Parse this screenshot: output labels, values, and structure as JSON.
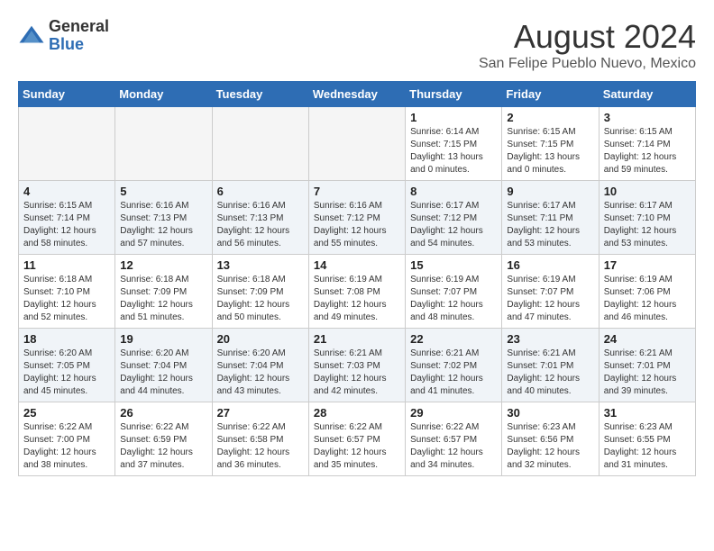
{
  "header": {
    "logo_general": "General",
    "logo_blue": "Blue",
    "month_year": "August 2024",
    "location": "San Felipe Pueblo Nuevo, Mexico"
  },
  "days_of_week": [
    "Sunday",
    "Monday",
    "Tuesday",
    "Wednesday",
    "Thursday",
    "Friday",
    "Saturday"
  ],
  "weeks": [
    [
      {
        "day": "",
        "info": "",
        "empty": true
      },
      {
        "day": "",
        "info": "",
        "empty": true
      },
      {
        "day": "",
        "info": "",
        "empty": true
      },
      {
        "day": "",
        "info": "",
        "empty": true
      },
      {
        "day": "1",
        "info": "Sunrise: 6:14 AM\nSunset: 7:15 PM\nDaylight: 13 hours\nand 0 minutes.",
        "empty": false
      },
      {
        "day": "2",
        "info": "Sunrise: 6:15 AM\nSunset: 7:15 PM\nDaylight: 13 hours\nand 0 minutes.",
        "empty": false
      },
      {
        "day": "3",
        "info": "Sunrise: 6:15 AM\nSunset: 7:14 PM\nDaylight: 12 hours\nand 59 minutes.",
        "empty": false
      }
    ],
    [
      {
        "day": "4",
        "info": "Sunrise: 6:15 AM\nSunset: 7:14 PM\nDaylight: 12 hours\nand 58 minutes.",
        "empty": false
      },
      {
        "day": "5",
        "info": "Sunrise: 6:16 AM\nSunset: 7:13 PM\nDaylight: 12 hours\nand 57 minutes.",
        "empty": false
      },
      {
        "day": "6",
        "info": "Sunrise: 6:16 AM\nSunset: 7:13 PM\nDaylight: 12 hours\nand 56 minutes.",
        "empty": false
      },
      {
        "day": "7",
        "info": "Sunrise: 6:16 AM\nSunset: 7:12 PM\nDaylight: 12 hours\nand 55 minutes.",
        "empty": false
      },
      {
        "day": "8",
        "info": "Sunrise: 6:17 AM\nSunset: 7:12 PM\nDaylight: 12 hours\nand 54 minutes.",
        "empty": false
      },
      {
        "day": "9",
        "info": "Sunrise: 6:17 AM\nSunset: 7:11 PM\nDaylight: 12 hours\nand 53 minutes.",
        "empty": false
      },
      {
        "day": "10",
        "info": "Sunrise: 6:17 AM\nSunset: 7:10 PM\nDaylight: 12 hours\nand 53 minutes.",
        "empty": false
      }
    ],
    [
      {
        "day": "11",
        "info": "Sunrise: 6:18 AM\nSunset: 7:10 PM\nDaylight: 12 hours\nand 52 minutes.",
        "empty": false
      },
      {
        "day": "12",
        "info": "Sunrise: 6:18 AM\nSunset: 7:09 PM\nDaylight: 12 hours\nand 51 minutes.",
        "empty": false
      },
      {
        "day": "13",
        "info": "Sunrise: 6:18 AM\nSunset: 7:09 PM\nDaylight: 12 hours\nand 50 minutes.",
        "empty": false
      },
      {
        "day": "14",
        "info": "Sunrise: 6:19 AM\nSunset: 7:08 PM\nDaylight: 12 hours\nand 49 minutes.",
        "empty": false
      },
      {
        "day": "15",
        "info": "Sunrise: 6:19 AM\nSunset: 7:07 PM\nDaylight: 12 hours\nand 48 minutes.",
        "empty": false
      },
      {
        "day": "16",
        "info": "Sunrise: 6:19 AM\nSunset: 7:07 PM\nDaylight: 12 hours\nand 47 minutes.",
        "empty": false
      },
      {
        "day": "17",
        "info": "Sunrise: 6:19 AM\nSunset: 7:06 PM\nDaylight: 12 hours\nand 46 minutes.",
        "empty": false
      }
    ],
    [
      {
        "day": "18",
        "info": "Sunrise: 6:20 AM\nSunset: 7:05 PM\nDaylight: 12 hours\nand 45 minutes.",
        "empty": false
      },
      {
        "day": "19",
        "info": "Sunrise: 6:20 AM\nSunset: 7:04 PM\nDaylight: 12 hours\nand 44 minutes.",
        "empty": false
      },
      {
        "day": "20",
        "info": "Sunrise: 6:20 AM\nSunset: 7:04 PM\nDaylight: 12 hours\nand 43 minutes.",
        "empty": false
      },
      {
        "day": "21",
        "info": "Sunrise: 6:21 AM\nSunset: 7:03 PM\nDaylight: 12 hours\nand 42 minutes.",
        "empty": false
      },
      {
        "day": "22",
        "info": "Sunrise: 6:21 AM\nSunset: 7:02 PM\nDaylight: 12 hours\nand 41 minutes.",
        "empty": false
      },
      {
        "day": "23",
        "info": "Sunrise: 6:21 AM\nSunset: 7:01 PM\nDaylight: 12 hours\nand 40 minutes.",
        "empty": false
      },
      {
        "day": "24",
        "info": "Sunrise: 6:21 AM\nSunset: 7:01 PM\nDaylight: 12 hours\nand 39 minutes.",
        "empty": false
      }
    ],
    [
      {
        "day": "25",
        "info": "Sunrise: 6:22 AM\nSunset: 7:00 PM\nDaylight: 12 hours\nand 38 minutes.",
        "empty": false
      },
      {
        "day": "26",
        "info": "Sunrise: 6:22 AM\nSunset: 6:59 PM\nDaylight: 12 hours\nand 37 minutes.",
        "empty": false
      },
      {
        "day": "27",
        "info": "Sunrise: 6:22 AM\nSunset: 6:58 PM\nDaylight: 12 hours\nand 36 minutes.",
        "empty": false
      },
      {
        "day": "28",
        "info": "Sunrise: 6:22 AM\nSunset: 6:57 PM\nDaylight: 12 hours\nand 35 minutes.",
        "empty": false
      },
      {
        "day": "29",
        "info": "Sunrise: 6:22 AM\nSunset: 6:57 PM\nDaylight: 12 hours\nand 34 minutes.",
        "empty": false
      },
      {
        "day": "30",
        "info": "Sunrise: 6:23 AM\nSunset: 6:56 PM\nDaylight: 12 hours\nand 32 minutes.",
        "empty": false
      },
      {
        "day": "31",
        "info": "Sunrise: 6:23 AM\nSunset: 6:55 PM\nDaylight: 12 hours\nand 31 minutes.",
        "empty": false
      }
    ]
  ]
}
